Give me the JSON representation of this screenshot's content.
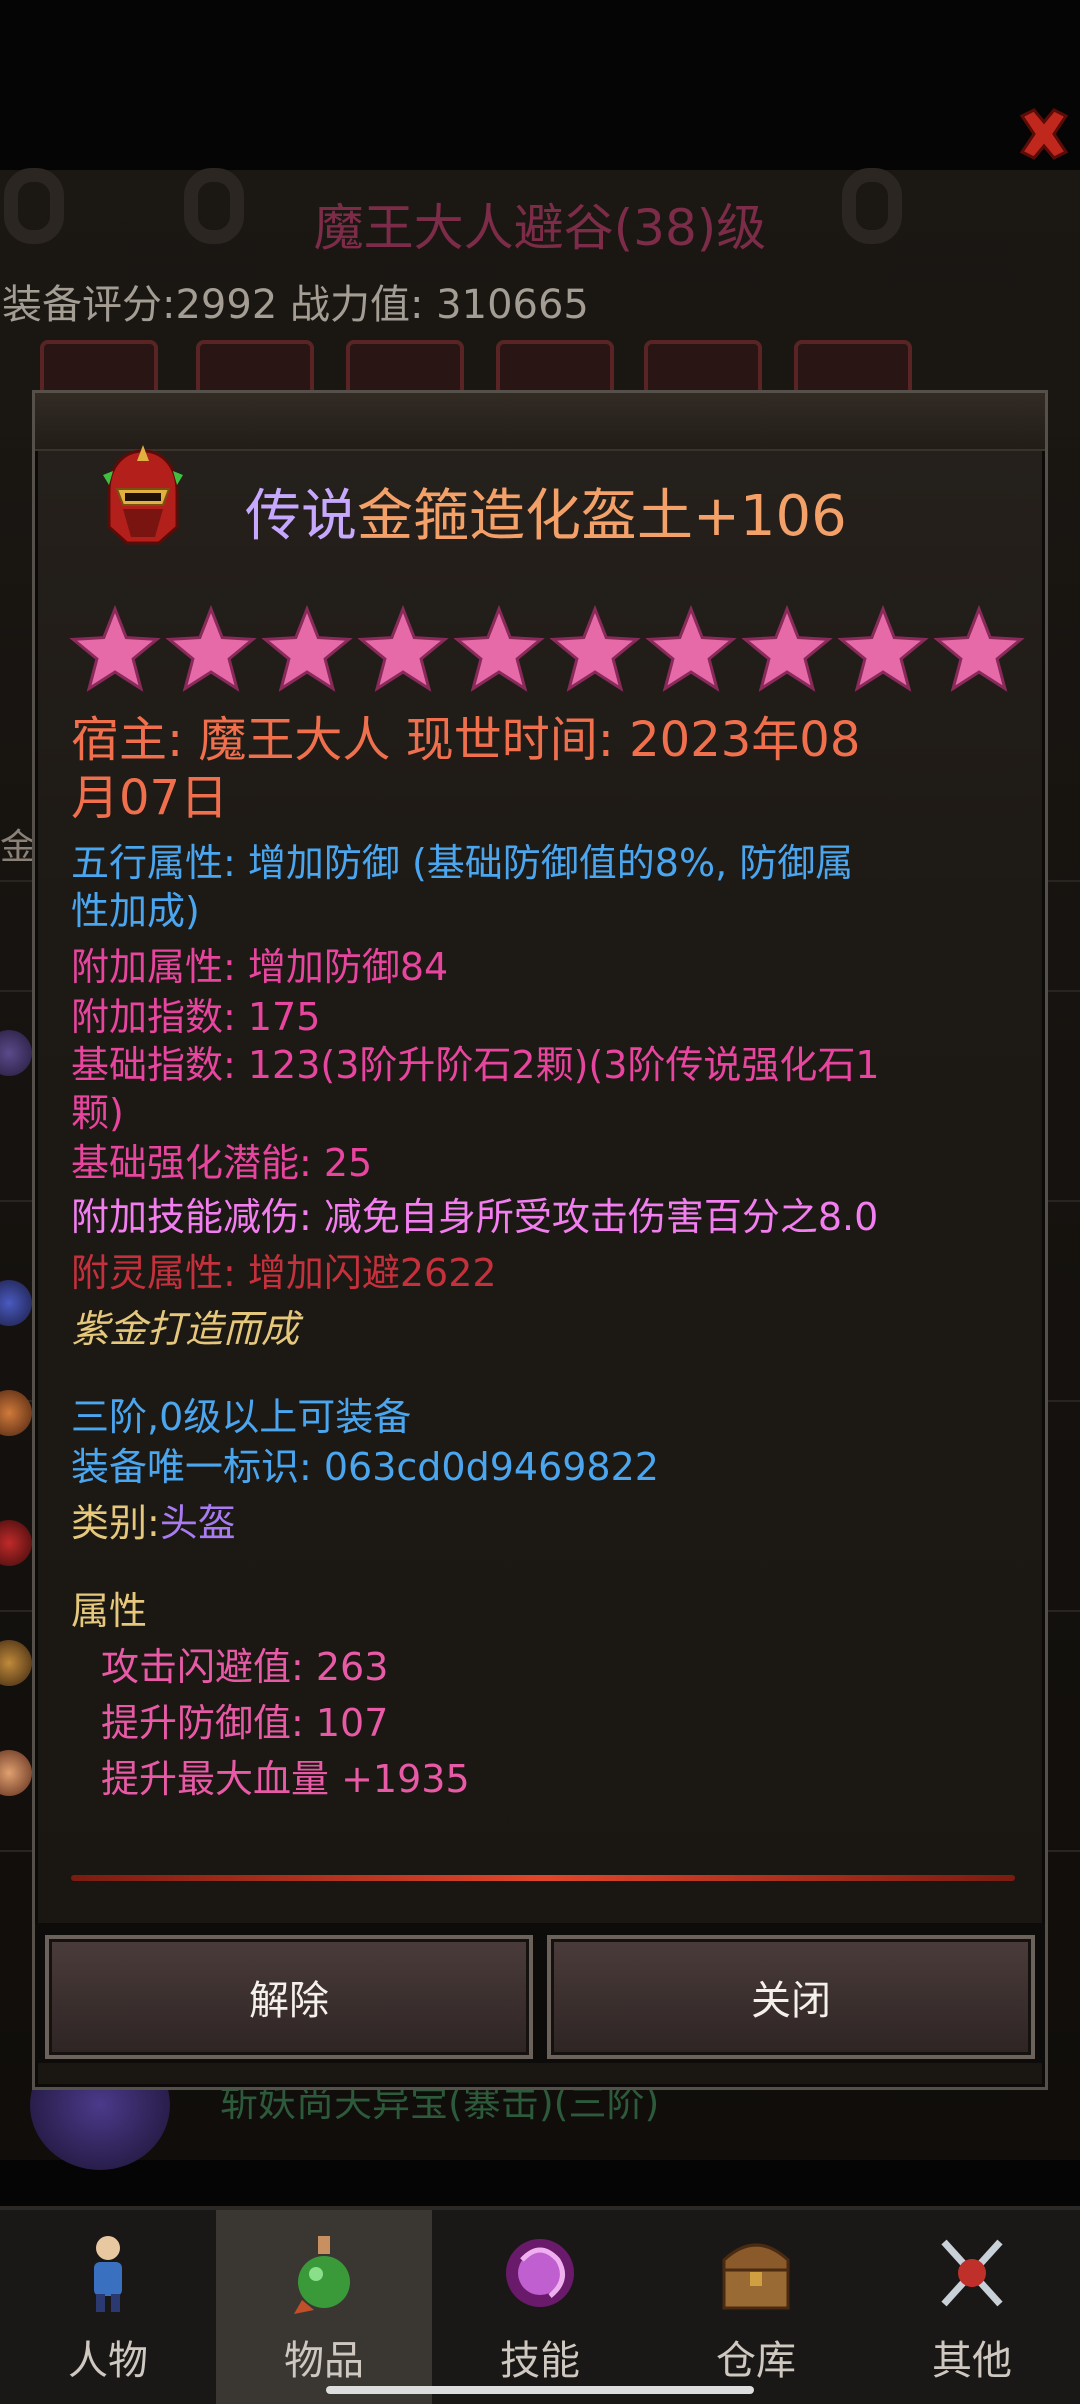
{
  "background": {
    "character_title": "魔王大人避谷(38)级",
    "score_line": "装备评分:2992  战力值: 310665",
    "side_text": "金",
    "behind_popup_text": "斩妖尚天异宝(寨击)(三阶)"
  },
  "popup": {
    "title_quality": "传说",
    "title_name": "金箍造化盔土+106",
    "stars_count": 10,
    "owner_line1": "宿主: 魔王大人  现世时间: 2023年08",
    "owner_line2": "月07日",
    "element_line1": "五行属性: 增加防御 (基础防御值的8%, 防御属",
    "element_line2": "性加成)",
    "extra_attr": "附加属性: 增加防御84",
    "extra_index": "附加指数: 175",
    "base_index_line1": "基础指数: 123(3阶升阶石2颗)(3阶传说强化石1",
    "base_index_line2": "颗)",
    "base_potential": "基础强化潜能: 25",
    "skill_reduction": "附加技能减伤: 减免自身所受攻击伤害百分之8.0",
    "spirit_attr": "附灵属性: 增加闪避2622",
    "forged_text": "紫金打造而成",
    "equip_req": "三阶,0级以上可装备",
    "unique_id": "装备唯一标识: 063cd0d9469822",
    "category_label": "类别:",
    "category_value": "头盔",
    "attr_header": "属性",
    "attrs": [
      "攻击闪避值: 263",
      "提升防御值: 107",
      "提升最大血量  +1935"
    ],
    "remove_button": "解除",
    "close_button": "关闭"
  },
  "bottom_nav": [
    {
      "label": "人物",
      "icon": "character-icon"
    },
    {
      "label": "物品",
      "icon": "potion-icon"
    },
    {
      "label": "技能",
      "icon": "skill-orb-icon"
    },
    {
      "label": "仓库",
      "icon": "chest-icon"
    },
    {
      "label": "其他",
      "icon": "crossed-swords-icon"
    }
  ],
  "colors": {
    "star": "#e66aa8",
    "title_quality": "#c7a8ff",
    "title_name": "#f3a168",
    "owner": "#f0704e",
    "element": "#4ba6f0",
    "pink_attr": "#e8459e",
    "skill": "#f27ef0",
    "spirit": "#c4303c",
    "forged": "#e6c87c",
    "category": "#a87cf0"
  }
}
